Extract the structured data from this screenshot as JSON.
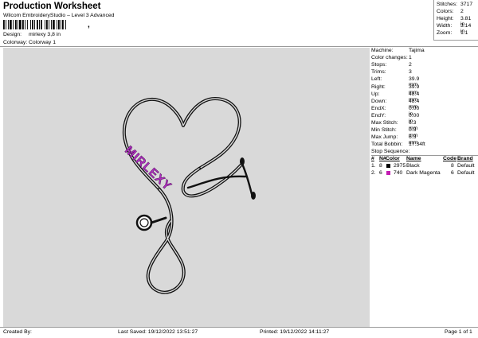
{
  "header": {
    "title": "Production Worksheet",
    "subtitle": "Wilcom EmbroideryStudio – Level 3 Advanced",
    "barcode_suffix": ","
  },
  "design_info": [
    {
      "label": "Design:",
      "value": "mirlexy 3,8 in"
    },
    {
      "label": "Colorway:",
      "value": "Colorway 1"
    }
  ],
  "stats": [
    {
      "label": "Stitches:",
      "value": "3717"
    },
    {
      "label": "Colors:",
      "value": "2"
    },
    {
      "label": "Height:",
      "value": "3.81 in"
    },
    {
      "label": "Width:",
      "value": "3.14 in"
    },
    {
      "label": "Zoom:",
      "value": "1:1"
    }
  ],
  "machine_info": [
    {
      "label": "Machine:",
      "value": "Tajima"
    },
    {
      "label": "Color changes:",
      "value": "1"
    },
    {
      "label": "Stops:",
      "value": "2"
    },
    {
      "label": "Trims:",
      "value": "3"
    },
    {
      "label": "Left:",
      "value": "39.9 mm"
    },
    {
      "label": "Right:",
      "value": "39.9 mm"
    },
    {
      "label": "Up:",
      "value": "48.4 mm"
    },
    {
      "label": "Down:",
      "value": "48.4 mm"
    },
    {
      "label": "EndX:",
      "value": "0.00 in"
    },
    {
      "label": "EndY:",
      "value": "0.00 in"
    },
    {
      "label": "Max Stitch:",
      "value": "6.3 mm"
    },
    {
      "label": "Min Stitch:",
      "value": "0.3 mm"
    },
    {
      "label": "Max Jump:",
      "value": "6.3 mm"
    },
    {
      "label": "Total Bobbin:",
      "value": "17.34ft"
    }
  ],
  "stop_sequence": {
    "title": "Stop Sequence:",
    "columns": [
      "#",
      "N#",
      "Color",
      "Name",
      "Code",
      "Brand"
    ],
    "rows": [
      {
        "index": "1.",
        "needle": "8",
        "swatch": "#000000",
        "color": "2975",
        "name": "Black",
        "code": "8",
        "brand": "Default"
      },
      {
        "index": "2.",
        "needle": "6",
        "swatch": "#c21bb1",
        "color": "740",
        "name": "Dark Magenta",
        "code": "6",
        "brand": "Default"
      }
    ]
  },
  "artwork": {
    "text": "MIRLEXY",
    "text_color": "#b32fc4",
    "outline_color": "#111111"
  },
  "footer": {
    "created_by": "Created By:",
    "last_saved": "Last Saved: 19/12/2022 13:51:27",
    "printed": "Printed: 19/12/2022 14:11:27",
    "page": "Page 1 of 1"
  }
}
